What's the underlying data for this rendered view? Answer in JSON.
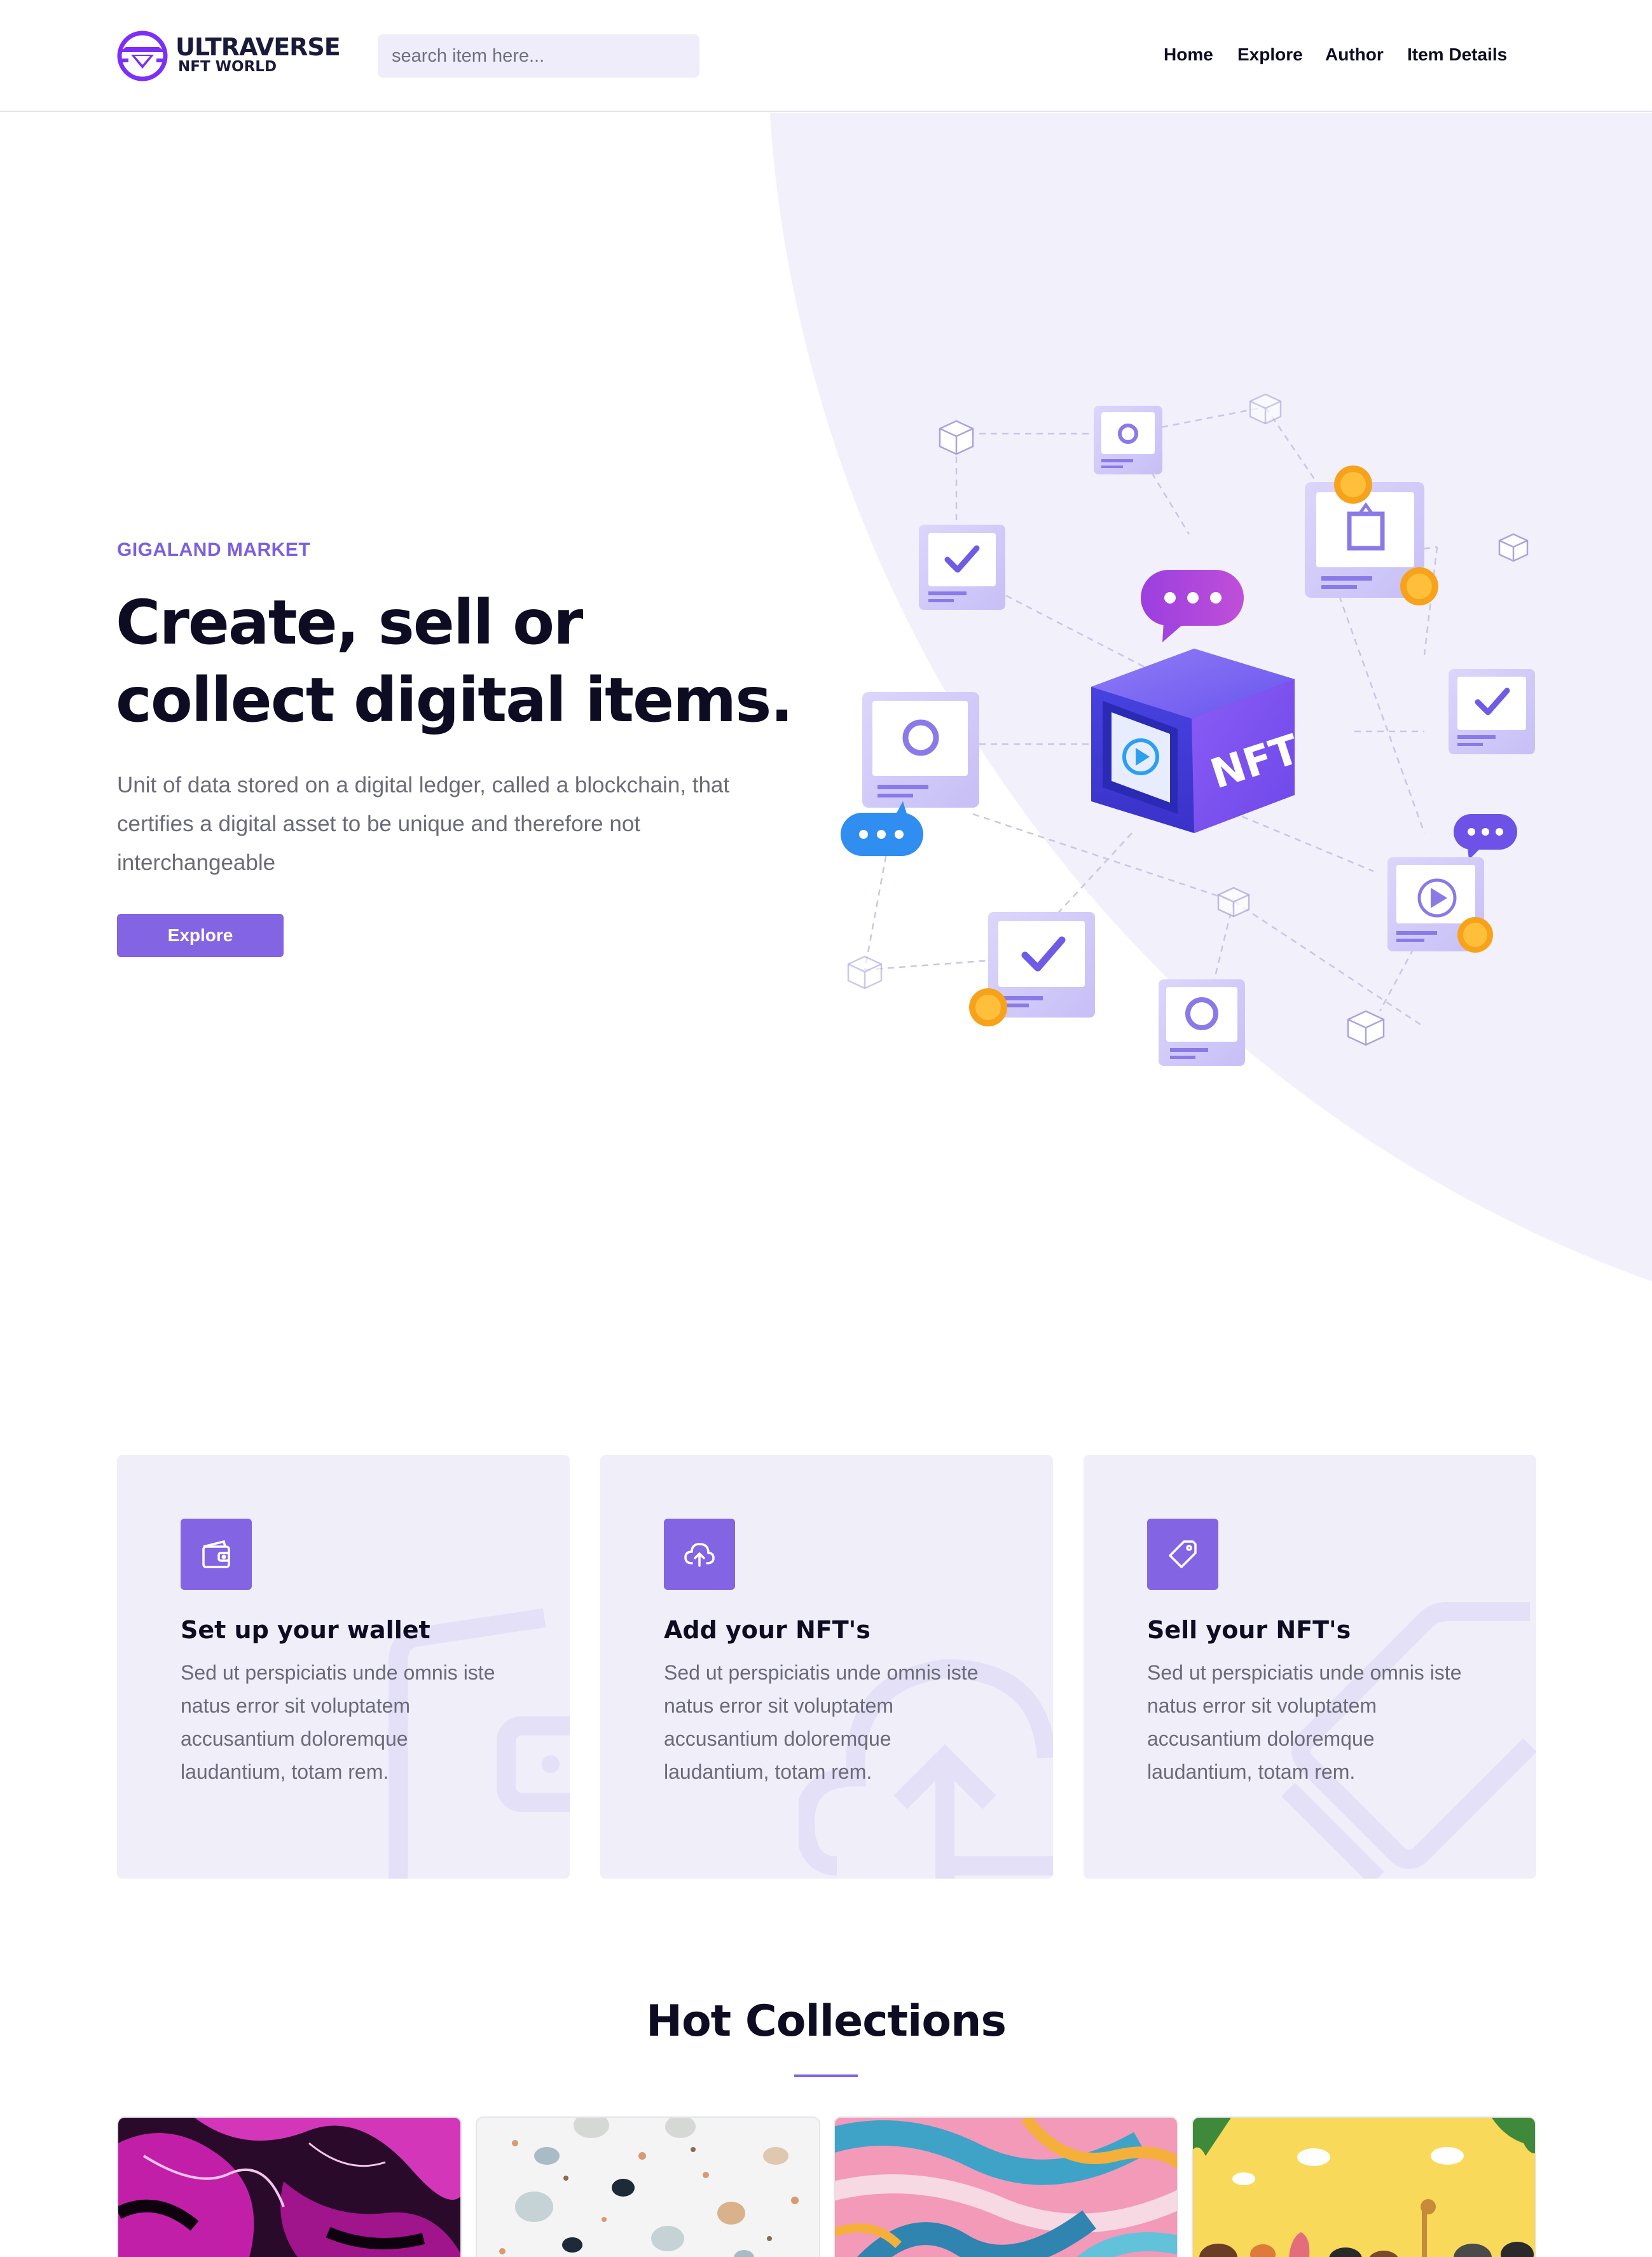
{
  "header": {
    "logo_title": "ULTRAVERSE",
    "logo_subtitle": "NFT WORLD",
    "search_placeholder": "search item here...",
    "nav": [
      {
        "label": "Home"
      },
      {
        "label": "Explore"
      },
      {
        "label": "Author"
      },
      {
        "label": "Item Details"
      }
    ]
  },
  "hero": {
    "eyebrow": "GIGALAND MARKET",
    "title": "Create, sell or collect digital items.",
    "description": "Unit of data stored on a digital ledger, called a blockchain, that certifies a digital asset to be unique and therefore not interchangeable",
    "button_label": "Explore",
    "illustration_text": "NFT"
  },
  "features": [
    {
      "icon": "wallet-icon",
      "title": "Set up your wallet",
      "text": "Sed ut perspiciatis unde omnis iste natus error sit voluptatem accusantium doloremque laudantium, totam rem."
    },
    {
      "icon": "cloud-upload-icon",
      "title": "Add your NFT's",
      "text": "Sed ut perspiciatis unde omnis iste natus error sit voluptatem accusantium doloremque laudantium, totam rem."
    },
    {
      "icon": "tag-icon",
      "title": "Sell your NFT's",
      "text": "Sed ut perspiciatis unde omnis iste natus error sit voluptatem accusantium doloremque laudantium, totam rem."
    }
  ],
  "hot_collections": {
    "title": "Hot Collections",
    "items": [
      {
        "theme": "pink-marble"
      },
      {
        "theme": "terrazzo"
      },
      {
        "theme": "brush-strokes"
      },
      {
        "theme": "animal-cartoon"
      }
    ]
  },
  "colors": {
    "accent": "#8364e2",
    "hero_bg": "#f2f0fb",
    "card_bg": "#f0eef9",
    "text_dark": "#0d0c22",
    "text_muted": "#6b6b78"
  }
}
